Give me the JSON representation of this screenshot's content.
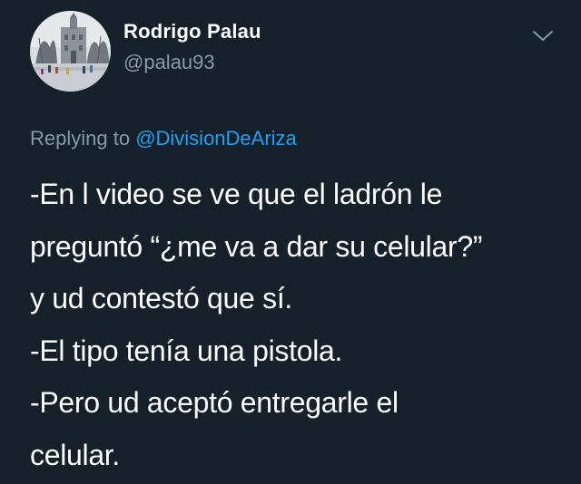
{
  "user": {
    "display_name": "Rodrigo Palau",
    "handle": "@palau93",
    "avatar_icon": "avatar-photo"
  },
  "reply": {
    "prefix": "Replying to ",
    "mention": "@DivisionDeAriza"
  },
  "tweet": {
    "lines": [
      "-En l video se ve que el ladrón le",
      "preguntó “¿me va a dar su celular?”",
      "y ud contestó que sí.",
      "-El tipo tenía una pistola.",
      "-Pero ud aceptó entregarle el",
      "celular."
    ]
  },
  "menu": {
    "icon": "chevron-down-icon"
  },
  "colors": {
    "background": "#15202b",
    "text": "#ffffff",
    "secondary": "#8899a6",
    "accent": "#1da1f2"
  }
}
